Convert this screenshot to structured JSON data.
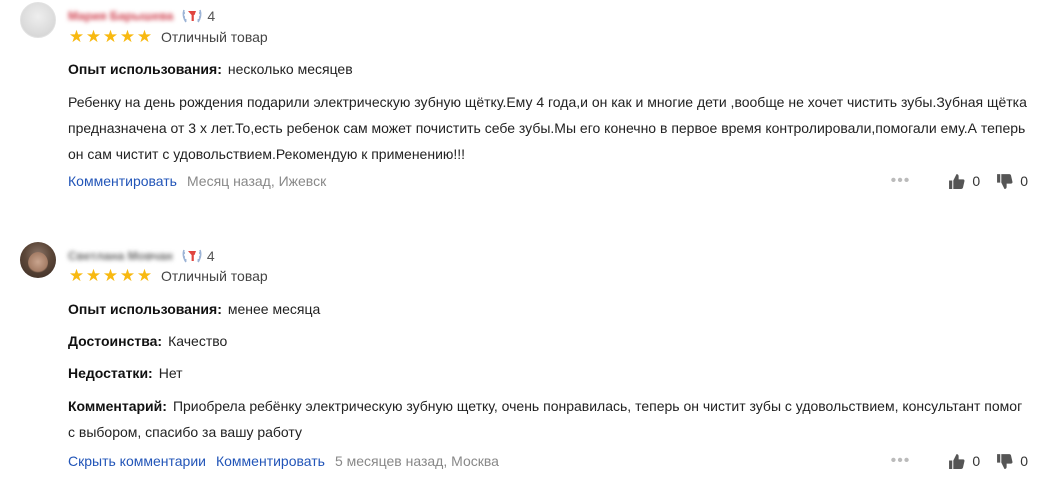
{
  "reviews": [
    {
      "author": "Мария Барышева",
      "grade": "4",
      "stars": 5,
      "rating_text": "Отличный товар",
      "usage_label": "Опыт использования:",
      "usage_value": "несколько месяцев",
      "text": "Ребенку на день рождения подарили электрическую зубную щётку.Ему 4 года,и он как и многие дети ,вообще не хочет чистить зубы.Зубная щётка предназначена от 3 х лет.То,есть ребенок сам может почистить себе зубы.Мы его конечно в первое время контролировали,помогали ему.А теперь он сам чистит с удовольствием.Рекомендую к применению!!!",
      "comment_link": "Комментировать",
      "meta": "Месяц назад, Ижевск",
      "likes": "0",
      "dislikes": "0"
    },
    {
      "author": "Светлана Мовчан",
      "grade": "4",
      "stars": 5,
      "rating_text": "Отличный товар",
      "usage_label": "Опыт использования:",
      "usage_value": "менее месяца",
      "pros_label": "Достоинства:",
      "pros_value": "Качество",
      "cons_label": "Недостатки:",
      "cons_value": "Нет",
      "comment_label": "Комментарий:",
      "comment_value": "Приобрела ребёнку электрическую зубную щетку, очень понравилась, теперь он чистит зубы с удовольствием, консультант помог с выбором, спасибо за вашу работу",
      "hide_comments_link": "Скрыть комментарии",
      "comment_link": "Комментировать",
      "meta": "5 месяцев назад, Москва",
      "likes": "0",
      "dislikes": "0"
    }
  ],
  "colors": {
    "star": "#f8b911",
    "link": "#2255b8",
    "meta": "#888888",
    "badge_red": "#e0453f",
    "badge_blue": "#3a66c4"
  },
  "icons": {
    "grade_badge": "laurel-badge-icon",
    "like": "thumb-up-icon",
    "dislike": "thumb-down-icon",
    "more": "more-dots-icon"
  }
}
